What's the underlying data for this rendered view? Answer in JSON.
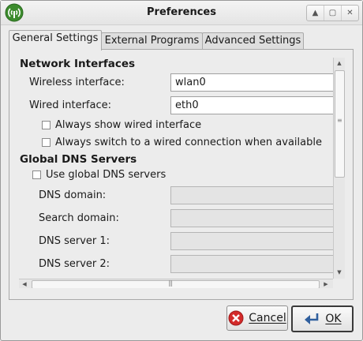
{
  "window": {
    "title": "Preferences",
    "controls": [
      "up-icon",
      "restore-icon",
      "close-icon"
    ]
  },
  "tabs": [
    {
      "label": "General Settings",
      "active": true
    },
    {
      "label": "External Programs",
      "active": false
    },
    {
      "label": "Advanced Settings",
      "active": false
    }
  ],
  "network": {
    "heading": "Network Interfaces",
    "wireless_label": "Wireless interface:",
    "wireless_value": "wlan0",
    "wired_label": "Wired interface:",
    "wired_value": "eth0",
    "always_show_wired": "Always show wired interface",
    "always_switch_wired": "Always switch to a wired connection when available"
  },
  "dns": {
    "heading": "Global DNS Servers",
    "use_global": "Use global DNS servers",
    "domain_label": "DNS domain:",
    "search_label": "Search domain:",
    "server1_label": "DNS server 1:",
    "server2_label": "DNS server 2:"
  },
  "buttons": {
    "cancel": "Cancel",
    "ok": "OK"
  },
  "colors": {
    "cancel_icon": "#d32a2a",
    "ok_icon": "#2f5f9e"
  }
}
